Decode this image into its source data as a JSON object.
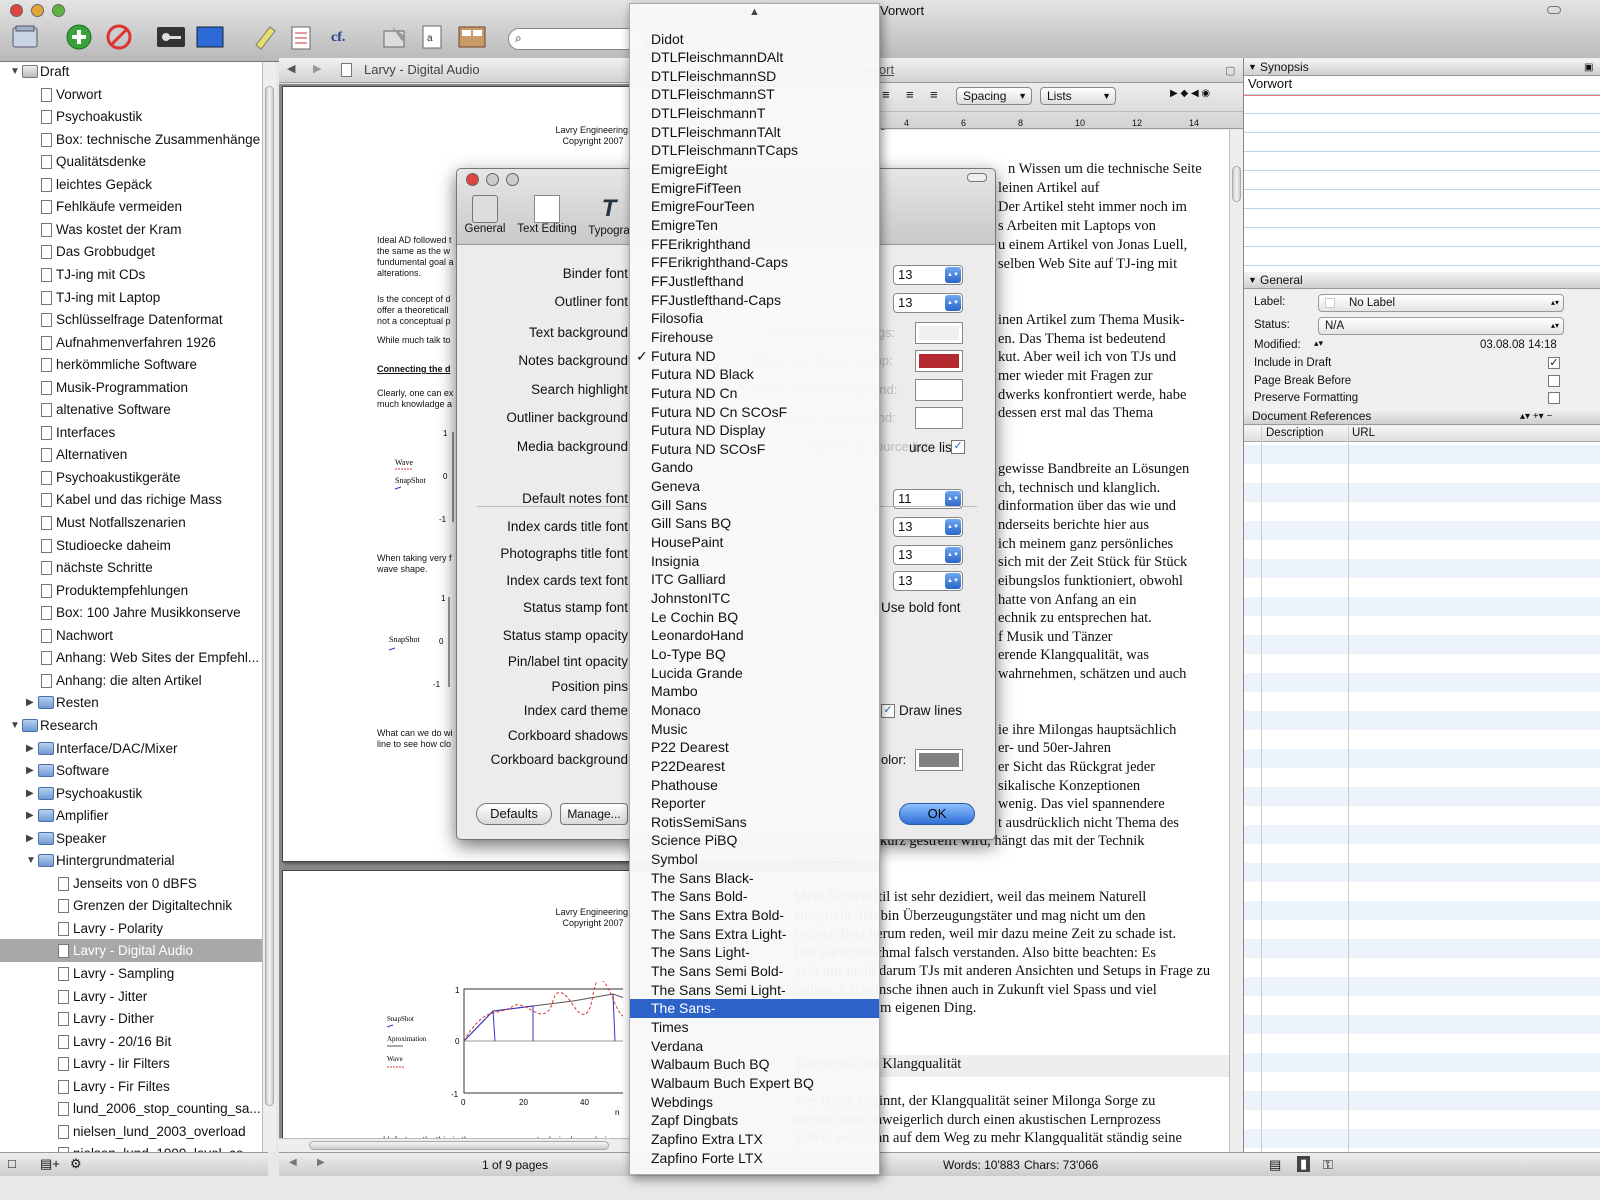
{
  "window": {
    "title": "Vorwort"
  },
  "toolbar": {
    "search_placeholder": ""
  },
  "binder": {
    "items": [
      {
        "label": "Draft",
        "type": "draft",
        "indent": 0,
        "disclosure": "open"
      },
      {
        "label": "Vorwort",
        "type": "doc",
        "indent": 1
      },
      {
        "label": "Psychoakustik",
        "type": "doc",
        "indent": 1
      },
      {
        "label": "Box: technische Zusammenhänge",
        "type": "doc",
        "indent": 1
      },
      {
        "label": "Qualitätsdenke",
        "type": "doc",
        "indent": 1
      },
      {
        "label": "leichtes Gepäck",
        "type": "doc",
        "indent": 1
      },
      {
        "label": "Fehlkäufe vermeiden",
        "type": "doc",
        "indent": 1
      },
      {
        "label": "Was kostet der Kram",
        "type": "doc",
        "indent": 1
      },
      {
        "label": "Das Grobbudget",
        "type": "doc",
        "indent": 1
      },
      {
        "label": "TJ-ing mit CDs",
        "type": "doc",
        "indent": 1
      },
      {
        "label": "TJ-ing mit Laptop",
        "type": "doc",
        "indent": 1
      },
      {
        "label": "Schlüsselfrage Datenformat",
        "type": "doc",
        "indent": 1
      },
      {
        "label": "Aufnahmenverfahren 1926",
        "type": "doc",
        "indent": 1
      },
      {
        "label": "herkömmliche Software",
        "type": "doc",
        "indent": 1
      },
      {
        "label": "Musik-Programmation",
        "type": "doc",
        "indent": 1
      },
      {
        "label": "altenative Software",
        "type": "doc",
        "indent": 1
      },
      {
        "label": "Interfaces",
        "type": "doc",
        "indent": 1
      },
      {
        "label": "Alternativen",
        "type": "doc",
        "indent": 1
      },
      {
        "label": "Psychoakustikgeräte",
        "type": "doc",
        "indent": 1
      },
      {
        "label": "Kabel und das richige Mass",
        "type": "doc",
        "indent": 1
      },
      {
        "label": "Must Notfallszenarien",
        "type": "doc",
        "indent": 1
      },
      {
        "label": "Studioecke daheim",
        "type": "doc",
        "indent": 1
      },
      {
        "label": "nächste Schritte",
        "type": "doc",
        "indent": 1
      },
      {
        "label": "Produktempfehlungen",
        "type": "doc",
        "indent": 1
      },
      {
        "label": "Box: 100 Jahre Musikkonserve",
        "type": "doc",
        "indent": 1
      },
      {
        "label": "Nachwort",
        "type": "doc",
        "indent": 1
      },
      {
        "label": "Anhang: Web Sites der Empfehl...",
        "type": "doc",
        "indent": 1
      },
      {
        "label": "Anhang: die alten Artikel",
        "type": "doc",
        "indent": 1
      },
      {
        "label": "Resten",
        "type": "folder",
        "indent": 1,
        "disclosure": "closed"
      },
      {
        "label": "Research",
        "type": "research",
        "indent": 0,
        "disclosure": "open"
      },
      {
        "label": "Interface/DAC/Mixer",
        "type": "folder",
        "indent": 1,
        "disclosure": "closed"
      },
      {
        "label": "Software",
        "type": "folder",
        "indent": 1,
        "disclosure": "closed"
      },
      {
        "label": "Psychoakustik",
        "type": "folder",
        "indent": 1,
        "disclosure": "closed"
      },
      {
        "label": "Amplifier",
        "type": "folder",
        "indent": 1,
        "disclosure": "closed"
      },
      {
        "label": "Speaker",
        "type": "folder",
        "indent": 1,
        "disclosure": "closed"
      },
      {
        "label": "Hintergrundmaterial",
        "type": "folder",
        "indent": 1,
        "disclosure": "open"
      },
      {
        "label": "Jenseits von 0 dBFS",
        "type": "doc",
        "indent": 2
      },
      {
        "label": "Grenzen der Digitaltechnik",
        "type": "doc",
        "indent": 2
      },
      {
        "label": "Lavry - Polarity",
        "type": "doc",
        "indent": 2
      },
      {
        "label": "Lavry - Digital Audio",
        "type": "doc",
        "indent": 2,
        "selected": true
      },
      {
        "label": "Lavry - Sampling",
        "type": "doc",
        "indent": 2
      },
      {
        "label": "Lavry - Jitter",
        "type": "doc",
        "indent": 2
      },
      {
        "label": "Lavry - Dither",
        "type": "doc",
        "indent": 2
      },
      {
        "label": "Lavry - 20/16 Bit",
        "type": "doc",
        "indent": 2
      },
      {
        "label": "Lavry - Iir Filters",
        "type": "doc",
        "indent": 2
      },
      {
        "label": "Lavry - Fir Filtes",
        "type": "doc",
        "indent": 2
      },
      {
        "label": "lund_2006_stop_counting_sa...",
        "type": "doc",
        "indent": 2
      },
      {
        "label": "nielsen_lund_2003_overload",
        "type": "doc",
        "indent": 2
      },
      {
        "label": "nielsen_lund_1999_level_co...",
        "type": "doc",
        "indent": 2
      }
    ]
  },
  "left_editor": {
    "path_title": "Larvy - Digital Audio",
    "page_count": "1 of 9 pages",
    "page1": {
      "header": "Lavry Engineering,\nCopyright 2007",
      "para1": [
        "Ideal AD followed t",
        "the same as the w",
        "fundumental goal a",
        "alterations."
      ],
      "para2": [
        "Is the concept of d",
        "offer a theoreticall",
        "not a conceptual p"
      ],
      "para3": "While much talk to",
      "heading": "Connecting the d",
      "para4": [
        "Clearly, one can ex",
        "much knowladge a"
      ],
      "chart1_legend": [
        "Wave",
        "SnapShot"
      ],
      "chart1_ticks": [
        "1",
        "0",
        "-1"
      ],
      "para5": [
        "When taking very f",
        "wave shape."
      ],
      "chart2_legend": [
        "SnapShot"
      ],
      "chart2_ticks": [
        "1",
        "0",
        "-1"
      ],
      "para6": [
        "What can we do wi",
        "line to see how clo"
      ]
    },
    "page2": {
      "header": "Lavry Engineering,\nCopyright 2007",
      "legend": [
        "SnapShot",
        "Aproximation",
        "Wave"
      ],
      "yticks": [
        "1",
        "0",
        "-1"
      ],
      "xticks": [
        "0",
        "20",
        "40"
      ],
      "xlabel": "n",
      "caption": "Unfortunatly, this is the way many non technical people in"
    }
  },
  "right_editor": {
    "tab_title": "Vorwort",
    "format": {
      "spacing": "Spacing",
      "lists": "Lists"
    },
    "ruler": [
      "4",
      "6",
      "8",
      "10",
      "12",
      "14"
    ],
    "lines": [
      {
        "y": 171,
        "x": 1008,
        "text": "n Wissen um die technische Seite"
      },
      {
        "y": 190,
        "x": 998,
        "text": "leinen Artikel auf"
      },
      {
        "y": 209,
        "x": 998,
        "text": "Der Artikel steht immer noch im"
      },
      {
        "y": 228,
        "x": 998,
        "text": "s Arbeiten mit Laptops von"
      },
      {
        "y": 247,
        "x": 998,
        "text": "u einem Artikel von Jonas Luell,"
      },
      {
        "y": 266,
        "x": 998,
        "text": "selben Web Site auf TJ-ing mit"
      },
      {
        "y": 322,
        "x": 998,
        "text": "inen Artikel zum Thema Musik-"
      },
      {
        "y": 341,
        "x": 998,
        "text": "en. Das Thema ist bedeutend"
      },
      {
        "y": 359,
        "x": 998,
        "text": "kut. Aber weil ich von TJs und"
      },
      {
        "y": 378,
        "x": 998,
        "text": "mer wieder mit Fragen zur"
      },
      {
        "y": 397,
        "x": 998,
        "text": "dwerks konfrontiert werde, habe"
      },
      {
        "y": 415,
        "x": 998,
        "text": "dessen erst mal das Thema"
      },
      {
        "y": 471,
        "x": 998,
        "text": "gewisse Bandbreite an Lösungen"
      },
      {
        "y": 490,
        "x": 998,
        "text": "ch, technisch und klanglich."
      },
      {
        "y": 508,
        "x": 998,
        "text": "dinformation über das wie und"
      },
      {
        "y": 527,
        "x": 998,
        "text": "nderseits  berichte hier aus"
      },
      {
        "y": 546,
        "x": 998,
        "text": "ich meinem ganz persönliches"
      },
      {
        "y": 564,
        "x": 998,
        "text": "sich mit der Zeit Stück für Stück"
      },
      {
        "y": 583,
        "x": 998,
        "text": "eibungslos funktioniert, obwohl"
      },
      {
        "y": 602,
        "x": 998,
        "text": " hatte von Anfang an ein"
      },
      {
        "y": 620,
        "x": 998,
        "text": "echnik zu entsprechen hat."
      },
      {
        "y": 639,
        "x": 998,
        "text": "f Musik und Tänzer"
      },
      {
        "y": 657,
        "x": 998,
        "text": "erende Klangqualität, was"
      },
      {
        "y": 676,
        "x": 998,
        "text": " wahrnehmen, schätzen und auch"
      },
      {
        "y": 732,
        "x": 998,
        "text": "ie ihre Milongas hauptsächlich"
      },
      {
        "y": 750,
        "x": 998,
        "text": "er- und 50er-Jahren"
      },
      {
        "y": 769,
        "x": 998,
        "text": "er Sicht das Rückgrat jeder"
      },
      {
        "y": 788,
        "x": 998,
        "text": "sikalische Konzeptionen"
      },
      {
        "y": 806,
        "x": 998,
        "text": " wenig. Das viel spannendere"
      },
      {
        "y": 825,
        "x": 998,
        "text": "t ausdrücklich nicht Thema des"
      },
      {
        "y": 843,
        "x": 880,
        "text": "kurz gestreift wird, hängt das mit der Technik"
      },
      {
        "y": 862,
        "x": 794,
        "text": "zusammen."
      },
      {
        "y": 899,
        "x": 794,
        "text": "Mein Schreibstil ist sehr dezidiert, weil das meinem Naturell"
      },
      {
        "y": 918,
        "x": 794,
        "text": "entspricht. Ich bin Überzeugungstäter und mag nicht um den"
      },
      {
        "y": 936,
        "x": 794,
        "text": "heissen Brei herum reden, weil mir dazu meine Zeit zu schade ist."
      },
      {
        "y": 955,
        "x": 794,
        "text": "Das wird manchmal falsch verstanden. Also bitte beachten: Es"
      },
      {
        "y": 973,
        "x": 794,
        "text": "geht mir nicht darum TJs mit anderen Ansichten und Setups in Frage zu"
      },
      {
        "y": 992,
        "x": 794,
        "text": "stellen. Ich wünsche ihnen auch in Zukunft viel Spass und viel"
      },
      {
        "y": 1010,
        "x": 794,
        "text": "Erfolg mit ihrem eigenen Ding."
      },
      {
        "y": 1066,
        "x": 794,
        "text": "Tangoguss mit Klangqualität"
      },
      {
        "y": 1103,
        "x": 794,
        "text": "Wer damit beginnt, der Klangqualität seiner Milonga Sorge zu"
      },
      {
        "y": 1122,
        "x": 794,
        "text": "tragen, wird unweigerlich durch einen akustischen Lernprozess"
      },
      {
        "y": 1140,
        "x": 794,
        "text": "gehen, weil man auf dem Weg zu mehr Klangqualität ständig seine"
      }
    ],
    "status": {
      "words": "Words: 10'883",
      "chars": "Chars: 73'066"
    }
  },
  "inspector": {
    "synopsis_header": "Synopsis",
    "synopsis_text": "Vorwort",
    "general_header": "General",
    "label_label": "Label:",
    "label_value": "No Label",
    "status_label": "Status:",
    "status_value": "N/A",
    "modified_label": "Modified:",
    "modified_value": "03.08.08 14:18",
    "include_in_draft": "Include in Draft",
    "page_break_before": "Page Break Before",
    "preserve_formatting": "Preserve Formatting",
    "doc_refs_header": "Document References",
    "col_description": "Description",
    "col_url": "URL"
  },
  "prefs": {
    "tabs": [
      "General",
      "Text Editing",
      "Typogra"
    ],
    "labels": [
      {
        "y": 274,
        "text": "Binder font"
      },
      {
        "y": 302,
        "text": "Outliner font"
      },
      {
        "y": 333,
        "text": "Text background"
      },
      {
        "y": 361,
        "text": "Notes background"
      },
      {
        "y": 390,
        "text": "Search highlight"
      },
      {
        "y": 418,
        "text": "Outliner background"
      },
      {
        "y": 447,
        "text": "Media background"
      },
      {
        "y": 499,
        "text": "Default notes font"
      },
      {
        "y": 527,
        "text": "Index cards title font"
      },
      {
        "y": 554,
        "text": "Photographs title font"
      },
      {
        "y": 581,
        "text": "Index cards text font"
      },
      {
        "y": 608,
        "text": "Status stamp font"
      },
      {
        "y": 636,
        "text": "Status stamp opacity"
      },
      {
        "y": 662,
        "text": "Pin/label tint opacity"
      },
      {
        "y": 687,
        "text": "Position pins"
      },
      {
        "y": 711,
        "text": "Index card theme"
      },
      {
        "y": 736,
        "text": "Corkboard shadows"
      },
      {
        "y": 760,
        "text": "Corkboard background"
      }
    ],
    "sizes": [
      {
        "y": 264,
        "value": "13"
      },
      {
        "y": 292,
        "value": "13"
      },
      {
        "y": 488,
        "value": "11"
      },
      {
        "y": 516,
        "value": "13"
      },
      {
        "y": 544,
        "value": "13"
      },
      {
        "y": 570,
        "value": "13"
      }
    ],
    "swatches": [
      {
        "y": 321,
        "color": "#f0f0f0"
      },
      {
        "y": 349,
        "color": "#b52a30"
      },
      {
        "y": 378,
        "color": "#ffffff"
      },
      {
        "y": 406,
        "color": "#ffffff"
      },
      {
        "y": 748,
        "color": "#808080"
      }
    ],
    "ghost_labels": [
      {
        "x": 770,
        "y": 333,
        "text": "Alternate scrivenings:"
      },
      {
        "x": 750,
        "y": 361,
        "text": "Index card status stamp:"
      },
      {
        "x": 754,
        "y": 390,
        "text": "Index cards background:"
      },
      {
        "x": 782,
        "y": 418,
        "text": "Binder background:"
      },
      {
        "x": 810,
        "y": 447,
        "text": "Binder as source list"
      }
    ],
    "source_list_label": "urce list",
    "use_bold_font": "Use bold font",
    "draw_lines": "Draw lines",
    "color_label": "olor:",
    "defaults_button": "Defaults",
    "manage_button": "Manage...",
    "ok_button": "OK"
  },
  "font_menu": {
    "items": [
      "Didot",
      "DTLFleischmannDAlt",
      "DTLFleischmannSD",
      "DTLFleischmannST",
      "DTLFleischmannT",
      "DTLFleischmannTAlt",
      "DTLFleischmannTCaps",
      "EmigreEight",
      "EmigreFifTeen",
      "EmigreFourTeen",
      "EmigreTen",
      "FFErikrighthand",
      "FFErikrighthand-Caps",
      "FFJustlefthand",
      "FFJustlefthand-Caps",
      "Filosofia",
      "Firehouse",
      "Futura ND",
      "Futura ND Black",
      "Futura ND Cn",
      "Futura ND Cn SCOsF",
      "Futura ND Display",
      "Futura ND SCOsF",
      "Gando",
      "Geneva",
      "Gill Sans",
      "Gill Sans BQ",
      "HousePaint",
      "Insignia",
      "ITC Galliard",
      "JohnstonITC",
      "Le Cochin BQ",
      "LeonardoHand",
      "Lo-Type BQ",
      "Lucida Grande",
      "Mambo",
      "Monaco",
      "Music",
      "P22 Dearest",
      "P22Dearest",
      "Phathouse",
      "Reporter",
      "RotisSemiSans",
      "Science PiBQ",
      "Symbol",
      "The Sans Black-",
      "The Sans Bold-",
      "The Sans Extra Bold-",
      "The Sans Extra Light-",
      "The Sans Light-",
      "The Sans Semi Bold-",
      "The Sans Semi Light-",
      "The Sans-",
      "Times",
      "Verdana",
      "Walbaum Buch BQ",
      "Walbaum Buch Expert BQ",
      "Webdings",
      "Zapf Dingbats",
      "Zapfino Extra LTX",
      "Zapfino Forte LTX"
    ],
    "checked": "Futura ND",
    "selected": "The Sans-"
  }
}
